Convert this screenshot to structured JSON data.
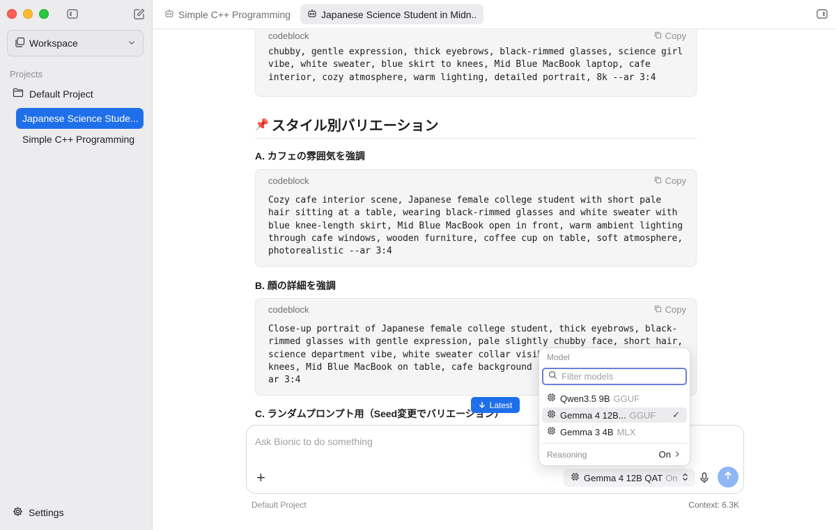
{
  "sidebar": {
    "workspace_label": "Workspace",
    "projects_label": "Projects",
    "project_name": "Default Project",
    "chats": [
      {
        "label": "Japanese Science Stude..."
      },
      {
        "label": "Simple C++ Programming"
      }
    ],
    "settings_label": "Settings"
  },
  "tabs": [
    {
      "label": "Simple C++ Programming"
    },
    {
      "label": "Japanese Science Student in Midn..."
    }
  ],
  "content": {
    "codeblock_label": "codeblock",
    "copy_label": "Copy",
    "block1": "chubby, gentle expression, thick eyebrows, black-rimmed glasses, science girl\nvibe, white sweater, blue skirt to knees, Mid Blue MacBook laptop, cafe\ninterior, cozy atmosphere, warm lighting, detailed portrait, 8k --ar 3:4",
    "heading": "スタイル別バリエーション",
    "heading_emoji": "📌",
    "sub_a": "A. カフェの雰囲気を強調",
    "block2": "Cozy cafe interior scene, Japanese female college student with short pale\nhair sitting at a table, wearing black-rimmed glasses and white sweater with\nblue knee-length skirt, Mid Blue MacBook open in front, warm ambient lighting\nthrough cafe windows, wooden furniture, coffee cup on table, soft atmosphere,\nphotorealistic --ar 3:4",
    "sub_b": "B. 顔の詳細を強調",
    "block3": "Close-up portrait of Japanese female college student, thick eyebrows, black-\nrimmed glasses with gentle expression, pale slightly chubby face, short hair,\nscience department vibe, white sweater collar visib\nknees, Mid Blue MacBook on table, cafe background s\nar 3:4",
    "sub_c": "C. ランダムプロンプト用（Seed変更でバリエーション）"
  },
  "latest_label": "Latest",
  "composer": {
    "placeholder": "Ask Bionic to do something",
    "model_label": "Gemma 4 12B QAT",
    "model_reasoning": "On"
  },
  "footer": {
    "project": "Default Project",
    "context": "Context: 6.3K"
  },
  "popover": {
    "title": "Model",
    "filter_placeholder": "Filter models",
    "models": [
      {
        "name": "Qwen3.5 9B",
        "format": "GGUF"
      },
      {
        "name": "Gemma 4 12B...",
        "format": "GGUF",
        "check": "✓"
      },
      {
        "name": "Gemma 3 4B",
        "format": "MLX"
      }
    ],
    "reasoning_label": "Reasoning",
    "reasoning_value": "On"
  }
}
